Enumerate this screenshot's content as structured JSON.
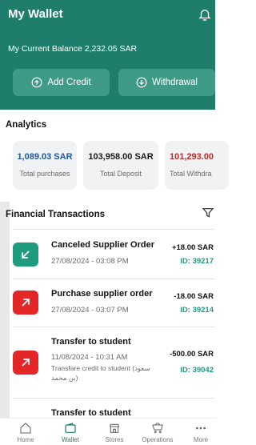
{
  "header": {
    "title": "My Wallet",
    "balance_text": "My Current Balance 2,232.05 SAR",
    "add_credit_label": "Add Credit",
    "withdrawal_label": "Withdrawal"
  },
  "analytics": {
    "title": "Analytics",
    "cards": [
      {
        "value": "1,089.03 SAR",
        "label": "Total purchases"
      },
      {
        "value": "103,958.00 SAR",
        "label": "Total Deposit"
      },
      {
        "value": "101,293.00",
        "label": "Total Withdra"
      }
    ]
  },
  "transactions": {
    "title": "Financial Transactions",
    "items": [
      {
        "title": "Canceled Supplier Order",
        "date": "27/08/2024 - 03:08 PM",
        "amount": "+18.00 SAR",
        "id": "ID: 39217",
        "type": "in"
      },
      {
        "title": "Purchase supplier order",
        "date": "27/08/2024 - 03:07 PM",
        "amount": "-18.00 SAR",
        "id": "ID: 39214",
        "type": "out"
      },
      {
        "title": "Transfer to student",
        "date": "11/08/2024 - 10:31 AM",
        "note": "Transfare credit to student (سعود بن محمد)",
        "amount": "-500.00 SAR",
        "id": "ID: 39042",
        "type": "out"
      },
      {
        "title": "Transfer to student"
      }
    ]
  },
  "nav": {
    "items": [
      {
        "label": "Home",
        "icon": "home-icon"
      },
      {
        "label": "Wallet",
        "icon": "wallet-icon",
        "active": true
      },
      {
        "label": "Stores",
        "icon": "store-icon"
      },
      {
        "label": "Operations",
        "icon": "cart-icon"
      },
      {
        "label": "More",
        "icon": "more-icon"
      }
    ]
  },
  "colors": {
    "primary": "#1f7d6b",
    "accent": "#1f9b80",
    "negative": "#e32727",
    "deposit_blue": "#1e58a8"
  }
}
